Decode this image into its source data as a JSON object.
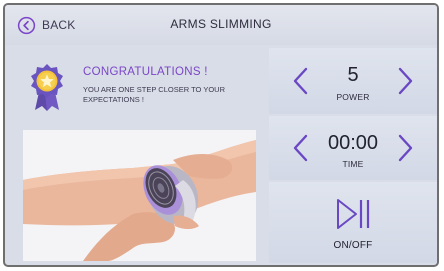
{
  "header": {
    "back_label": "BACK",
    "title": "ARMS SLIMMING"
  },
  "congrats": {
    "title": "CONGRATULATIONS !",
    "message": "YOU ARE ONE STEP CLOSER TO YOUR EXPECTATIONS !"
  },
  "power": {
    "value": "5",
    "label": "POWER"
  },
  "time": {
    "value": "00:00",
    "label": "TIME"
  },
  "onoff": {
    "label": "ON/OFF"
  },
  "icons": {
    "back": "back-circle-icon",
    "medal": "medal-star-icon",
    "decrease": "chevron-left-icon",
    "increase": "chevron-right-icon",
    "play_pause": "play-pause-icon"
  },
  "colors": {
    "accent": "#7a45c8",
    "panel_bg": "#d9dde7",
    "text_dark": "#232230"
  }
}
